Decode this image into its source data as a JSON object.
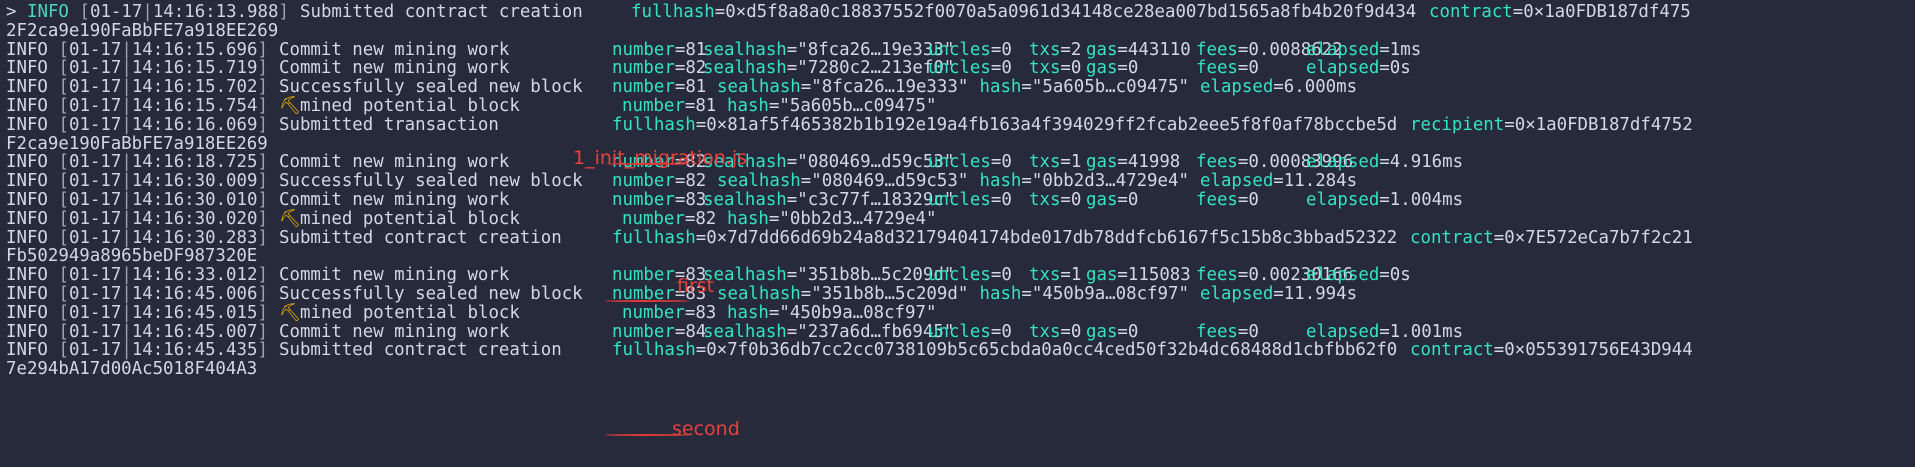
{
  "terminal": {
    "lines": [
      {
        "prompt": ">",
        "level": "INFO",
        "date": "01-17",
        "time": "14:16:13.988",
        "message": "Submitted contract creation",
        "fields": [
          {
            "k": "fullhash",
            "v": "0×d5f8a8a0c18837552f0070a5a0961d34148ce28ea007bd1565a8fb4b20f9d434"
          },
          {
            "k": "contract",
            "v": "0×1a0FDB187df475"
          }
        ]
      },
      {
        "wrap": "2F2ca9e190FaBbFE7a918EE269"
      },
      {
        "level": "INFO",
        "date": "01-17",
        "time": "14:16:15.696",
        "message": "Commit new mining work",
        "fields": [
          {
            "k": "number",
            "v": "81"
          },
          {
            "k": "sealhash",
            "v": "\"8fca26…19e333\""
          },
          {
            "k": "uncles",
            "v": "0"
          },
          {
            "k": "txs",
            "v": "2"
          },
          {
            "k": "gas",
            "v": "443110"
          },
          {
            "k": "fees",
            "v": "0.0088622"
          },
          {
            "k": "elapsed",
            "v": "1ms"
          }
        ]
      },
      {
        "level": "INFO",
        "date": "01-17",
        "time": "14:16:15.719",
        "message": "Commit new mining work",
        "fields": [
          {
            "k": "number",
            "v": "82"
          },
          {
            "k": "sealhash",
            "v": "\"7280c2…213ef0\""
          },
          {
            "k": "uncles",
            "v": "0"
          },
          {
            "k": "txs",
            "v": "0"
          },
          {
            "k": "gas",
            "v": "0"
          },
          {
            "k": "fees",
            "v": "0"
          },
          {
            "k": "elapsed",
            "v": "0s"
          }
        ]
      },
      {
        "level": "INFO",
        "date": "01-17",
        "time": "14:16:15.702",
        "message": "Successfully sealed new block",
        "fields": [
          {
            "k": "number",
            "v": "81"
          },
          {
            "k": "sealhash",
            "v": "\"8fca26…19e333\""
          },
          {
            "k": "hash",
            "v": "\"5a605b…c09475\""
          },
          {
            "k": "elapsed",
            "v": "6.000ms"
          }
        ]
      },
      {
        "level": "INFO",
        "date": "01-17",
        "time": "14:16:15.754",
        "icon": "⛏",
        "message": "mined potential block",
        "fields": [
          {
            "k": "number",
            "v": "81"
          },
          {
            "k": "hash",
            "v": "\"5a605b…c09475\""
          }
        ]
      },
      {
        "level": "INFO",
        "date": "01-17",
        "time": "14:16:16.069",
        "message": "Submitted transaction",
        "fields": [
          {
            "k": "fullhash",
            "v": "0×81af5f465382b1b192e19a4fb163a4f394029ff2fcab2eee5f8f0af78bccbe5d"
          },
          {
            "k": "recipient",
            "v": "0×1a0FDB187df4752"
          }
        ]
      },
      {
        "wrap": "F2ca9e190FaBbFE7a918EE269"
      },
      {
        "level": "INFO",
        "date": "01-17",
        "time": "14:16:18.725",
        "message": "Commit new mining work",
        "fields": [
          {
            "k": "number",
            "v": "82"
          },
          {
            "k": "sealhash",
            "v": "\"080469…d59c53\""
          },
          {
            "k": "uncles",
            "v": "0"
          },
          {
            "k": "txs",
            "v": "1"
          },
          {
            "k": "gas",
            "v": "41998"
          },
          {
            "k": "fees",
            "v": "0.00083996"
          },
          {
            "k": "elapsed",
            "v": "4.916ms"
          }
        ]
      },
      {
        "level": "INFO",
        "date": "01-17",
        "time": "14:16:30.009",
        "message": "Successfully sealed new block",
        "fields": [
          {
            "k": "number",
            "v": "82"
          },
          {
            "k": "sealhash",
            "v": "\"080469…d59c53\""
          },
          {
            "k": "hash",
            "v": "\"0bb2d3…4729e4\""
          },
          {
            "k": "elapsed",
            "v": "11.284s"
          }
        ]
      },
      {
        "level": "INFO",
        "date": "01-17",
        "time": "14:16:30.010",
        "message": "Commit new mining work",
        "fields": [
          {
            "k": "number",
            "v": "83"
          },
          {
            "k": "sealhash",
            "v": "\"c3c77f…18329c\""
          },
          {
            "k": "uncles",
            "v": "0"
          },
          {
            "k": "txs",
            "v": "0"
          },
          {
            "k": "gas",
            "v": "0"
          },
          {
            "k": "fees",
            "v": "0"
          },
          {
            "k": "elapsed",
            "v": "1.004ms"
          }
        ]
      },
      {
        "level": "INFO",
        "date": "01-17",
        "time": "14:16:30.020",
        "icon": "⛏",
        "message": "mined potential block",
        "fields": [
          {
            "k": "number",
            "v": "82"
          },
          {
            "k": "hash",
            "v": "\"0bb2d3…4729e4\""
          }
        ]
      },
      {
        "level": "INFO",
        "date": "01-17",
        "time": "14:16:30.283",
        "message": "Submitted contract creation",
        "fields": [
          {
            "k": "fullhash",
            "v": "0×7d7dd66d69b24a8d32179404174bde017db78ddfcb6167f5c15b8c3bbad52322"
          },
          {
            "k": "contract",
            "v": "0×7E572eCa7b7f2c21"
          }
        ]
      },
      {
        "wrap": "Fb502949a8965beDF987320E"
      },
      {
        "level": "INFO",
        "date": "01-17",
        "time": "14:16:33.012",
        "message": "Commit new mining work",
        "fields": [
          {
            "k": "number",
            "v": "83"
          },
          {
            "k": "sealhash",
            "v": "\"351b8b…5c209d\""
          },
          {
            "k": "uncles",
            "v": "0"
          },
          {
            "k": "txs",
            "v": "1"
          },
          {
            "k": "gas",
            "v": "115083"
          },
          {
            "k": "fees",
            "v": "0.00230166"
          },
          {
            "k": "elapsed",
            "v": "0s"
          }
        ]
      },
      {
        "level": "INFO",
        "date": "01-17",
        "time": "14:16:45.006",
        "message": "Successfully sealed new block",
        "fields": [
          {
            "k": "number",
            "v": "83"
          },
          {
            "k": "sealhash",
            "v": "\"351b8b…5c209d\""
          },
          {
            "k": "hash",
            "v": "\"450b9a…08cf97\""
          },
          {
            "k": "elapsed",
            "v": "11.994s"
          }
        ]
      },
      {
        "level": "INFO",
        "date": "01-17",
        "time": "14:16:45.015",
        "icon": "⛏",
        "message": "mined potential block",
        "fields": [
          {
            "k": "number",
            "v": "83"
          },
          {
            "k": "hash",
            "v": "\"450b9a…08cf97\""
          }
        ]
      },
      {
        "level": "INFO",
        "date": "01-17",
        "time": "14:16:45.007",
        "message": "Commit new mining work",
        "fields": [
          {
            "k": "number",
            "v": "84"
          },
          {
            "k": "sealhash",
            "v": "\"237a6d…fb6945\""
          },
          {
            "k": "uncles",
            "v": "0"
          },
          {
            "k": "txs",
            "v": "0"
          },
          {
            "k": "gas",
            "v": "0"
          },
          {
            "k": "fees",
            "v": "0"
          },
          {
            "k": "elapsed",
            "v": "1.001ms"
          }
        ]
      },
      {
        "level": "INFO",
        "date": "01-17",
        "time": "14:16:45.435",
        "message": "Submitted contract creation",
        "fields": [
          {
            "k": "fullhash",
            "v": "0×7f0b36db7cc2cc0738109b5c65cbda0a0cc4ced50f32b4dc68488d1cbfbb62f0"
          },
          {
            "k": "contract",
            "v": "0×055391756E43D944"
          }
        ]
      },
      {
        "wrap": "7e294bA17d00Ac5018F404A3"
      }
    ],
    "annotations": [
      {
        "text": "1_init_migration.js"
      },
      {
        "text": "first"
      },
      {
        "text": "second"
      }
    ],
    "colors": {
      "background": "#262a3b",
      "field_key": "#33e3c2",
      "text": "#d4d7e3",
      "annotation": "#e8413c",
      "pick_icon": "#f4b400"
    }
  }
}
